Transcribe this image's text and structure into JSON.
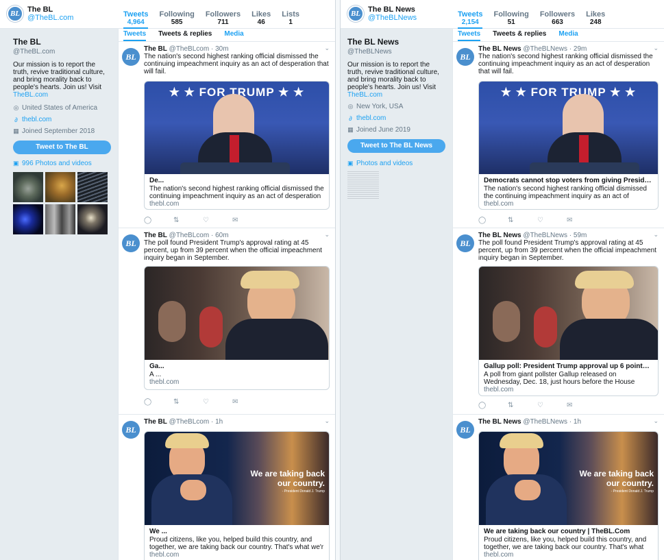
{
  "left": {
    "header": {
      "avatar_text": "BL",
      "name": "The BL",
      "handle": "@TheBL.com",
      "stats": [
        {
          "label": "Tweets",
          "value": "4,964"
        },
        {
          "label": "Following",
          "value": "585"
        },
        {
          "label": "Followers",
          "value": "711"
        },
        {
          "label": "Likes",
          "value": "46"
        },
        {
          "label": "Lists",
          "value": "1"
        }
      ]
    },
    "profile": {
      "name": "The BL",
      "handle": "@TheBL.com",
      "bio": "Our mission is to report the truth, revive traditional culture, and bring morality back to people's hearts. Join us! Visit",
      "bio_link": "TheBL.com",
      "location": "United States of America",
      "website": "thebl.com",
      "joined": "Joined September 2018",
      "tweet_button": "Tweet to The BL",
      "photos_label": "996 Photos and videos"
    },
    "tabs": [
      "Tweets",
      "Tweets & replies",
      "Media"
    ],
    "tweets": [
      {
        "name": "The BL",
        "meta": "@TheBLcom · 30m",
        "text": "The nation's second highest ranking official dismissed the continuing impeachment inquiry as an act of desperation that will fail.",
        "image_caption": "★ ★ FOR TRUMP ★ ★",
        "card_title": "De...",
        "card_desc": "The nation's second highest ranking official dismissed the continuing impeachment inquiry as an act of desperation",
        "card_domain": "thebl.com"
      },
      {
        "name": "The BL",
        "meta": "@TheBLcom · 60m",
        "text": "The poll found President Trump's approval rating at 45 percent, up from 39 percent when the official impeachment inquiry began in September.",
        "card_title": "Ga...",
        "card_desc": "A ...",
        "card_domain": "thebl.com"
      },
      {
        "name": "The BL",
        "meta": "@TheBLcom · 1h",
        "text": "",
        "image_line1": "We are taking back",
        "image_line2": "our country.",
        "image_attr": "- President Donald J. Trump",
        "card_title": "We ...",
        "card_desc": "Proud citizens, like you, helped build this country, and together, we are taking back our country. That's what we'r",
        "card_domain": "thebl.com"
      }
    ]
  },
  "right": {
    "header": {
      "avatar_text": "BL",
      "name": "The BL News",
      "handle": "@TheBLNews",
      "stats": [
        {
          "label": "Tweets",
          "value": "2,154"
        },
        {
          "label": "Following",
          "value": "51"
        },
        {
          "label": "Followers",
          "value": "663"
        },
        {
          "label": "Likes",
          "value": "248"
        }
      ]
    },
    "profile": {
      "name": "The BL News",
      "handle": "@TheBLNews",
      "bio": "Our mission is to report the truth, revive traditional culture, and bring morality back to people's hearts. Join us! Visit",
      "bio_link": "TheBL.com",
      "location": "New York, USA",
      "website": "thebl.com",
      "joined": "Joined June 2019",
      "tweet_button": "Tweet to The BL News",
      "photos_label": "Photos and videos"
    },
    "tabs": [
      "Tweets",
      "Tweets & replies",
      "Media"
    ],
    "tweets": [
      {
        "name": "The BL News",
        "meta": "@TheBLNews · 29m",
        "text": "The nation's second highest ranking official dismissed the continuing impeachment inquiry as an act of desperation that will fail.",
        "image_caption": "★ ★ FOR TRUMP ★ ★",
        "card_title": "Democrats cannot stop voters from giving President ...",
        "card_desc": "The nation's second highest ranking official dismissed the continuing impeachment inquiry as an act of desperation",
        "card_domain": "thebl.com"
      },
      {
        "name": "The BL News",
        "meta": "@TheBLNews · 59m",
        "text": "The poll found President Trump's approval rating at 45 percent, up from 39 percent when the official impeachment inquiry began in September.",
        "card_title": "Gallup poll: President Trump approval up 6 points sin...",
        "card_desc": "A poll from giant pollster Gallup released on Wednesday, Dec. 18, just hours before the House voted on impeach...",
        "card_domain": "thebl.com"
      },
      {
        "name": "The BL News",
        "meta": "@TheBLNews · 1h",
        "text": "",
        "image_line1": "We are taking back",
        "image_line2": "our country.",
        "image_attr": "- President Donald J. Trump",
        "card_title": "We are taking back our country | TheBL.Com",
        "card_desc": "Proud citizens, like you, helped build this country, and together, we are taking back our country. That's what we'r",
        "card_domain": "thebl.com"
      }
    ]
  },
  "icons": {
    "location": "location-icon",
    "link": "link-icon",
    "calendar": "calendar-icon",
    "photos": "photo-icon",
    "reply": "reply-icon",
    "retweet": "retweet-icon",
    "like": "like-icon",
    "dm": "message-icon",
    "caret": "chevron-down-icon"
  }
}
